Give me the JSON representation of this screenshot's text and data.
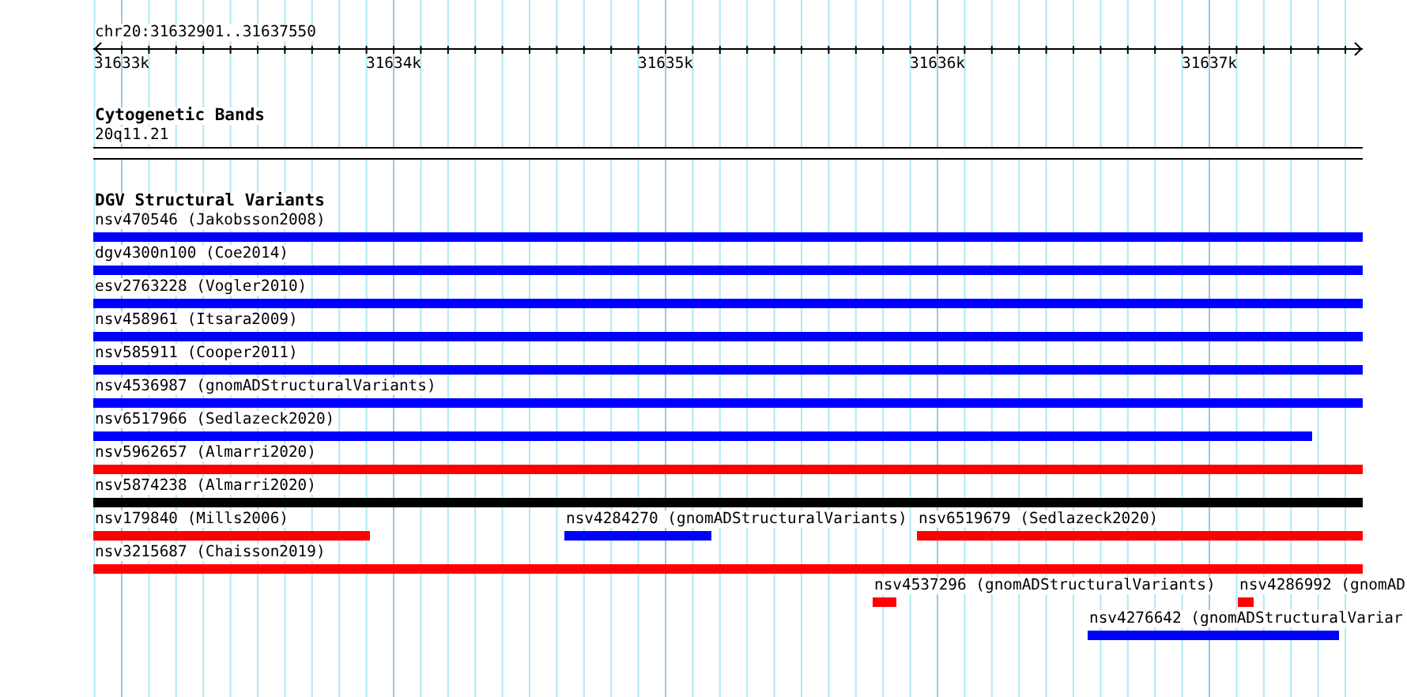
{
  "ruler": {
    "location": "chr20:31632901..31637550",
    "ticks": [
      "31633k",
      "31634k",
      "31635k",
      "31636k",
      "31637k"
    ]
  },
  "tracks": [
    {
      "title": "Cytogenetic Bands",
      "kind": "bands",
      "lanes": [
        {
          "features": [
            {
              "label": "20q11.21"
            }
          ]
        }
      ]
    },
    {
      "title": "DGV Structural Variants",
      "kind": "variants",
      "lanes": [
        {
          "features": [
            {
              "label": "nsv470546 (Jakobsson2008)",
              "color": "#0000ff"
            }
          ]
        },
        {
          "features": [
            {
              "label": "dgv4300n100 (Coe2014)",
              "color": "#0000ff"
            }
          ]
        },
        {
          "features": [
            {
              "label": "esv2763228 (Vogler2010)",
              "color": "#0000ff"
            }
          ]
        },
        {
          "features": [
            {
              "label": "nsv458961 (Itsara2009)",
              "color": "#0000ff"
            }
          ]
        },
        {
          "features": [
            {
              "label": "nsv585911 (Cooper2011)",
              "color": "#0000ff"
            }
          ]
        },
        {
          "features": [
            {
              "label": "nsv4536987 (gnomADStructuralVariants)",
              "color": "#0000ff"
            }
          ]
        },
        {
          "features": [
            {
              "label": "nsv6517966 (Sedlazeck2020)",
              "color": "#0000ff"
            }
          ]
        },
        {
          "features": [
            {
              "label": "nsv5962657 (Almarri2020)",
              "color": "#ff0000"
            }
          ]
        },
        {
          "features": [
            {
              "label": "nsv5874238 (Almarri2020)",
              "color": "#000000"
            }
          ]
        },
        {
          "features": [
            {
              "label": "nsv179840 (Mills2006)",
              "color": "#ff0000"
            },
            {
              "label": "nsv4284270 (gnomADStructuralVariants)",
              "color": "#0000ff"
            },
            {
              "label": "nsv6519679 (Sedlazeck2020)",
              "color": "#ff0000"
            }
          ]
        },
        {
          "features": [
            {
              "label": "nsv3215687 (Chaisson2019)",
              "color": "#ff0000"
            }
          ]
        },
        {
          "features": [
            {
              "label": "nsv4537296 (gnomADStructuralVariants)",
              "color": "#ff0000"
            },
            {
              "label": "nsv4286992 (gnomAD",
              "color": "#ff0000"
            }
          ]
        },
        {
          "features": [
            {
              "label": "nsv4276642 (gnomADStructuralVariar",
              "color": "#0000ff"
            }
          ]
        }
      ]
    }
  ]
}
